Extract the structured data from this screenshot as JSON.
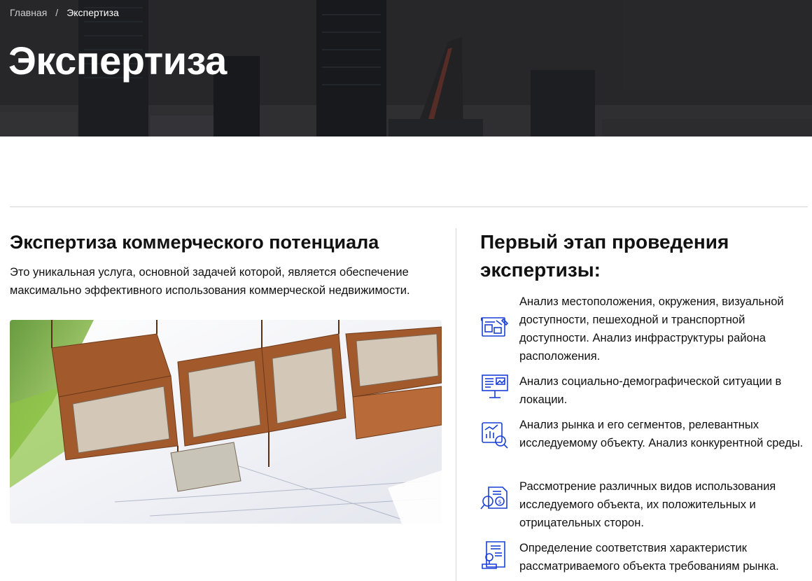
{
  "breadcrumb": {
    "home": "Главная",
    "separator": "/",
    "current": "Экспертиза"
  },
  "hero": {
    "title": "Экспертиза"
  },
  "left": {
    "title": "Экспертиза коммерческого потенциала",
    "description": "Это уникальная услуга, основной задачей которой, является обеспечение максимально эффективного использования коммерческой недвижимости."
  },
  "right": {
    "title": "Первый этап проведения экспертизы:",
    "steps": [
      {
        "icon": "blueprint-icon",
        "text": "Анализ местоположения, окружения, визуальной доступности, пешеходной и транспортной доступности. Анализ инфраструктуры района расположения."
      },
      {
        "icon": "presentation-board-icon",
        "text": "Анализ социально-демографической ситуации в локации."
      },
      {
        "icon": "market-analysis-icon",
        "text": "Анализ рынка и его сегментов, релевантных исследуемому объекту. Анализ конкурентной среды."
      },
      {
        "icon": "review-search-icon",
        "text": "Рассмотрение различных видов использования исследуемого объекта, их положительных и отрицательных сторон."
      },
      {
        "icon": "certificate-document-icon",
        "text": "Определение соответствия характеристик рассматриваемого объекта требованиям рынка."
      }
    ]
  },
  "colors": {
    "icon_blue": "#1a3fd6",
    "text": "#111111",
    "hero_dark": "#2f2f31"
  }
}
